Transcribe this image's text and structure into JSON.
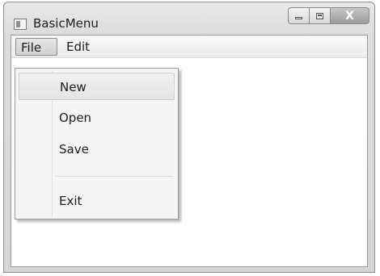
{
  "window": {
    "title": "BasicMenu"
  },
  "caption_buttons": {
    "minimize_icon": "minimize-icon",
    "maximize_icon": "maximize-icon",
    "close_label": "X"
  },
  "menubar": {
    "items": [
      {
        "label": "File"
      },
      {
        "label": "Edit"
      }
    ]
  },
  "file_menu": {
    "items": [
      {
        "label": "New"
      },
      {
        "label": "Open"
      },
      {
        "label": "Save"
      },
      {
        "label": "Exit"
      }
    ]
  }
}
